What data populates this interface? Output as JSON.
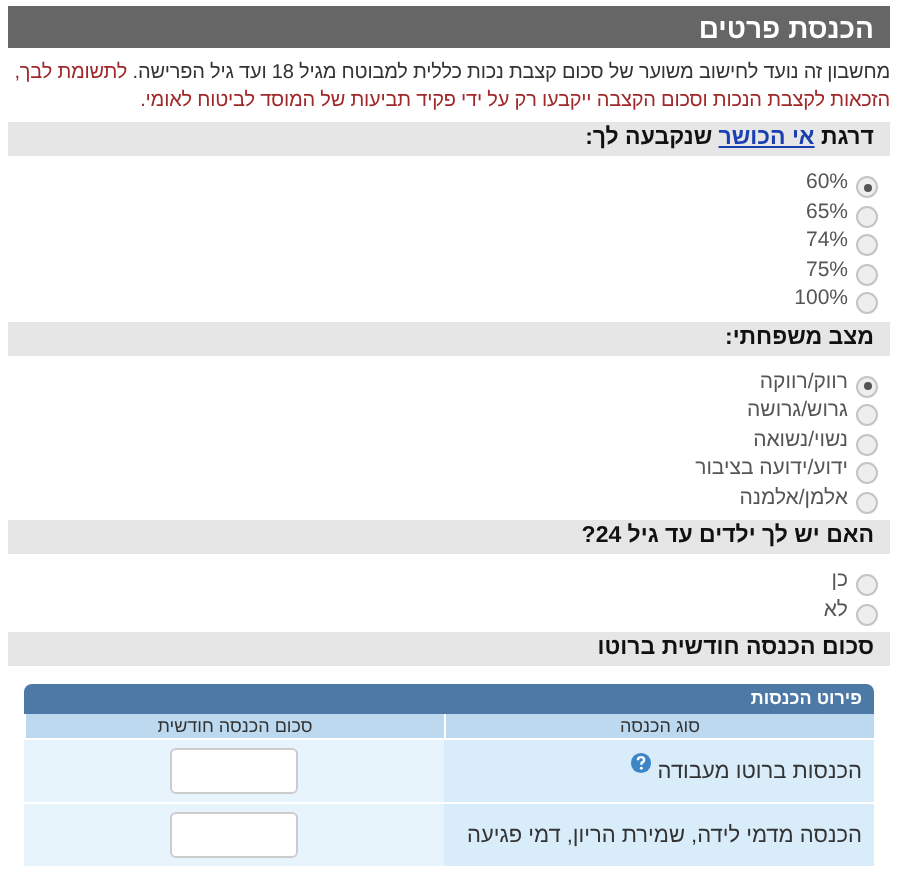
{
  "header": {
    "title": "הכנסת פרטים"
  },
  "intro": {
    "text": "מחשבון זה נועד לחישוב משוער של סכום קצבת נכות כללית למבוטח מגיל 18 ועד גיל הפרישה.",
    "notice": "לתשומת לבך, הזכאות לקצבת הנכות וסכום הקצבה ייקבעו רק על ידי פקיד תביעות של המוסד לביטוח לאומי."
  },
  "sections": [
    {
      "kind": "radio",
      "title": "דרגת",
      "link": "אי הכושר",
      "title_end": "שנקבעה לך:",
      "options": [
        {
          "label": "60%",
          "selected": true
        },
        {
          "label": "65%",
          "selected": false
        },
        {
          "label": "74%",
          "selected": false
        },
        {
          "label": "75%",
          "selected": false
        },
        {
          "label": "100%",
          "selected": false
        }
      ]
    },
    {
      "kind": "radio",
      "title": "מצב משפחתי:",
      "options": [
        {
          "label": "רווק/רווקה",
          "selected": true
        },
        {
          "label": "גרוש/גרושה",
          "selected": false
        },
        {
          "label": "נשוי/נשואה",
          "selected": false
        },
        {
          "label": "ידוע/ידועה בציבור",
          "selected": false
        },
        {
          "label": "אלמן/אלמנה",
          "selected": false
        }
      ]
    },
    {
      "kind": "radio",
      "title": "האם יש לך ילדים עד גיל 24?",
      "options": [
        {
          "label": "כן",
          "selected": false
        },
        {
          "label": "לא",
          "selected": false
        }
      ]
    },
    {
      "kind": "table",
      "title": "סכום הכנסה חודשית ברוטו",
      "table": {
        "title": "פירוט הכנסות",
        "columns": [
          "סוג הכנסה",
          "סכום הכנסה חודשית"
        ],
        "rows": [
          {
            "label": "הכנסות ברוטו מעבודה",
            "help": true
          },
          {
            "label": "הכנסה מדמי לידה, שמירת הריון, דמי פגיעה",
            "help": false
          }
        ]
      }
    }
  ]
}
